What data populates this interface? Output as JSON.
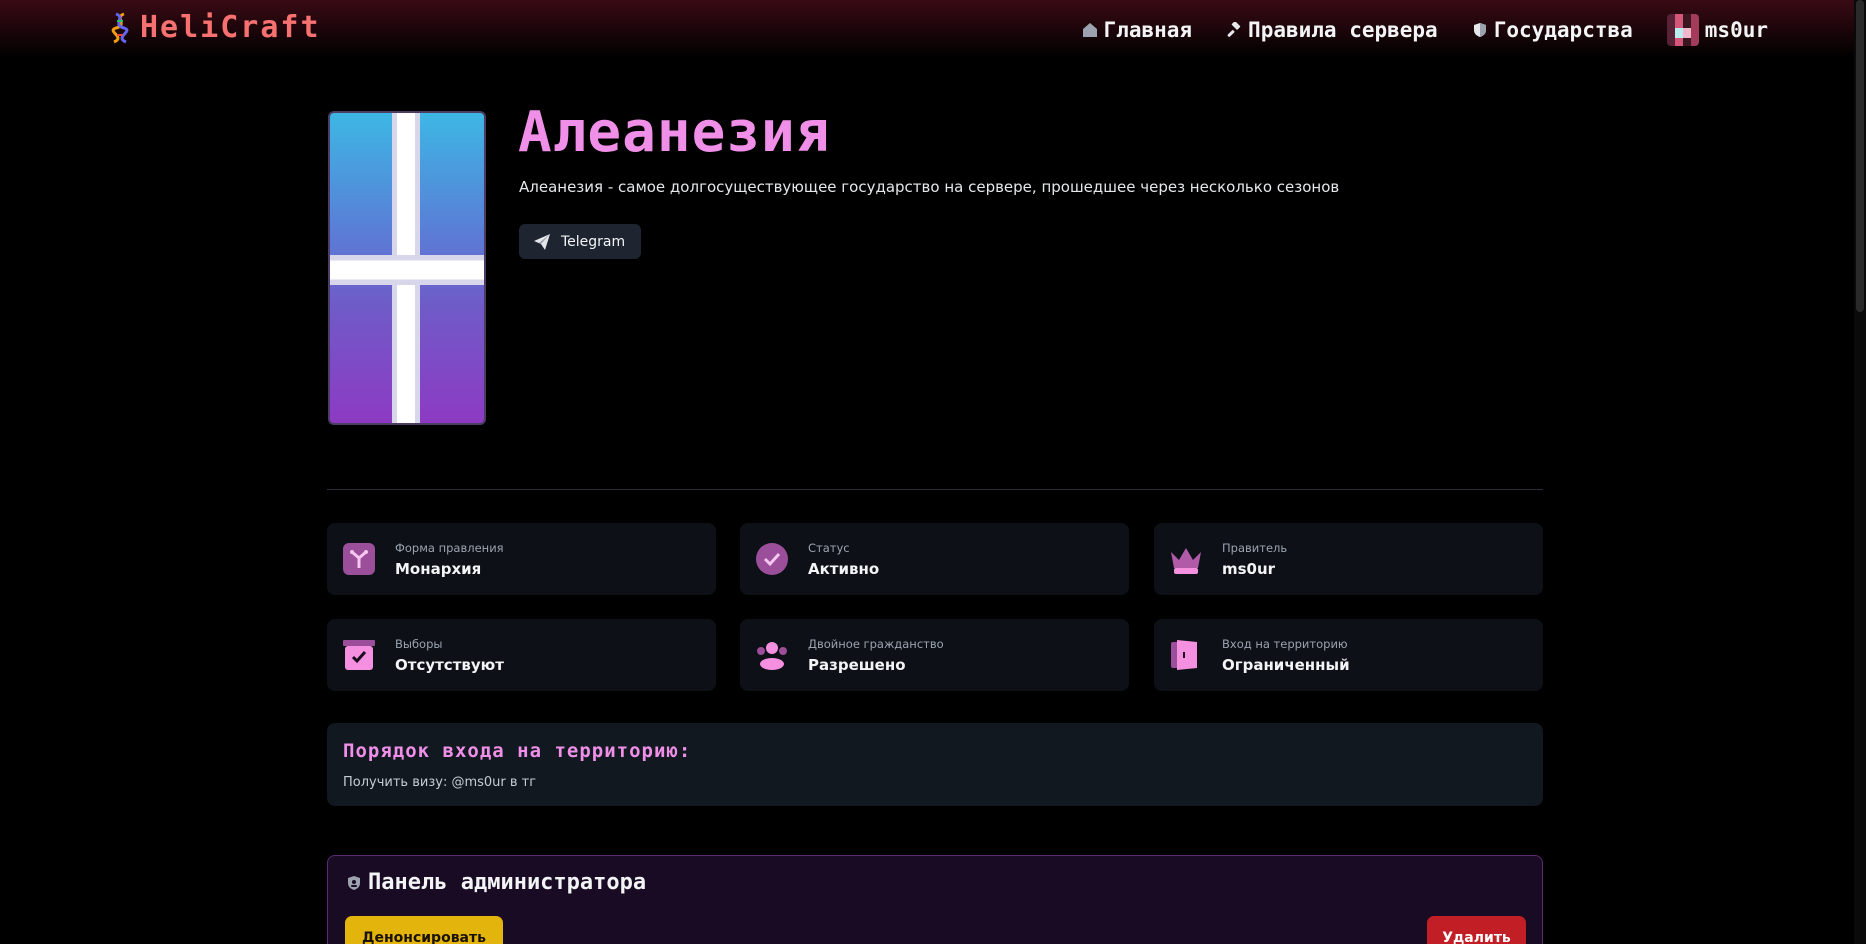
{
  "header": {
    "logo_text": "HeliCraft",
    "nav": [
      {
        "label": "Главная",
        "icon": "home-icon"
      },
      {
        "label": "Правила сервера",
        "icon": "gavel-icon"
      },
      {
        "label": "Государства",
        "icon": "shield-icon"
      }
    ],
    "user": {
      "name": "ms0ur",
      "icon": "avatar"
    }
  },
  "state": {
    "name": "Алеанезия",
    "description": "Алеанезия - самое долгосуществующее государство на сервере, прошедшее через несколько сезонов",
    "telegram_label": "Telegram"
  },
  "info_cards": [
    {
      "label": "Форма правления",
      "value": "Монархия",
      "icon": "government-icon"
    },
    {
      "label": "Статус",
      "value": "Активно",
      "icon": "check-circle-icon"
    },
    {
      "label": "Правитель",
      "value": "ms0ur",
      "icon": "crown-icon"
    },
    {
      "label": "Выборы",
      "value": "Отсутствуют",
      "icon": "ballot-box-icon"
    },
    {
      "label": "Двойное гражданство",
      "value": "Разрешено",
      "icon": "users-icon"
    },
    {
      "label": "Вход на территорию",
      "value": "Ограниченный",
      "icon": "door-icon"
    }
  ],
  "entry": {
    "title": "Порядок входа на территорию:",
    "text": "Получить визу: @ms0ur в тг"
  },
  "admin": {
    "title": "Панель администратора",
    "denounce_label": "Денонсировать",
    "delete_label": "Удалить"
  },
  "colors": {
    "accent_pink": "#f08fe8",
    "logo_red": "#f87171",
    "card_bg": "#0d1117",
    "warning_yellow": "#e3b40c",
    "danger_red": "#c11f25"
  }
}
